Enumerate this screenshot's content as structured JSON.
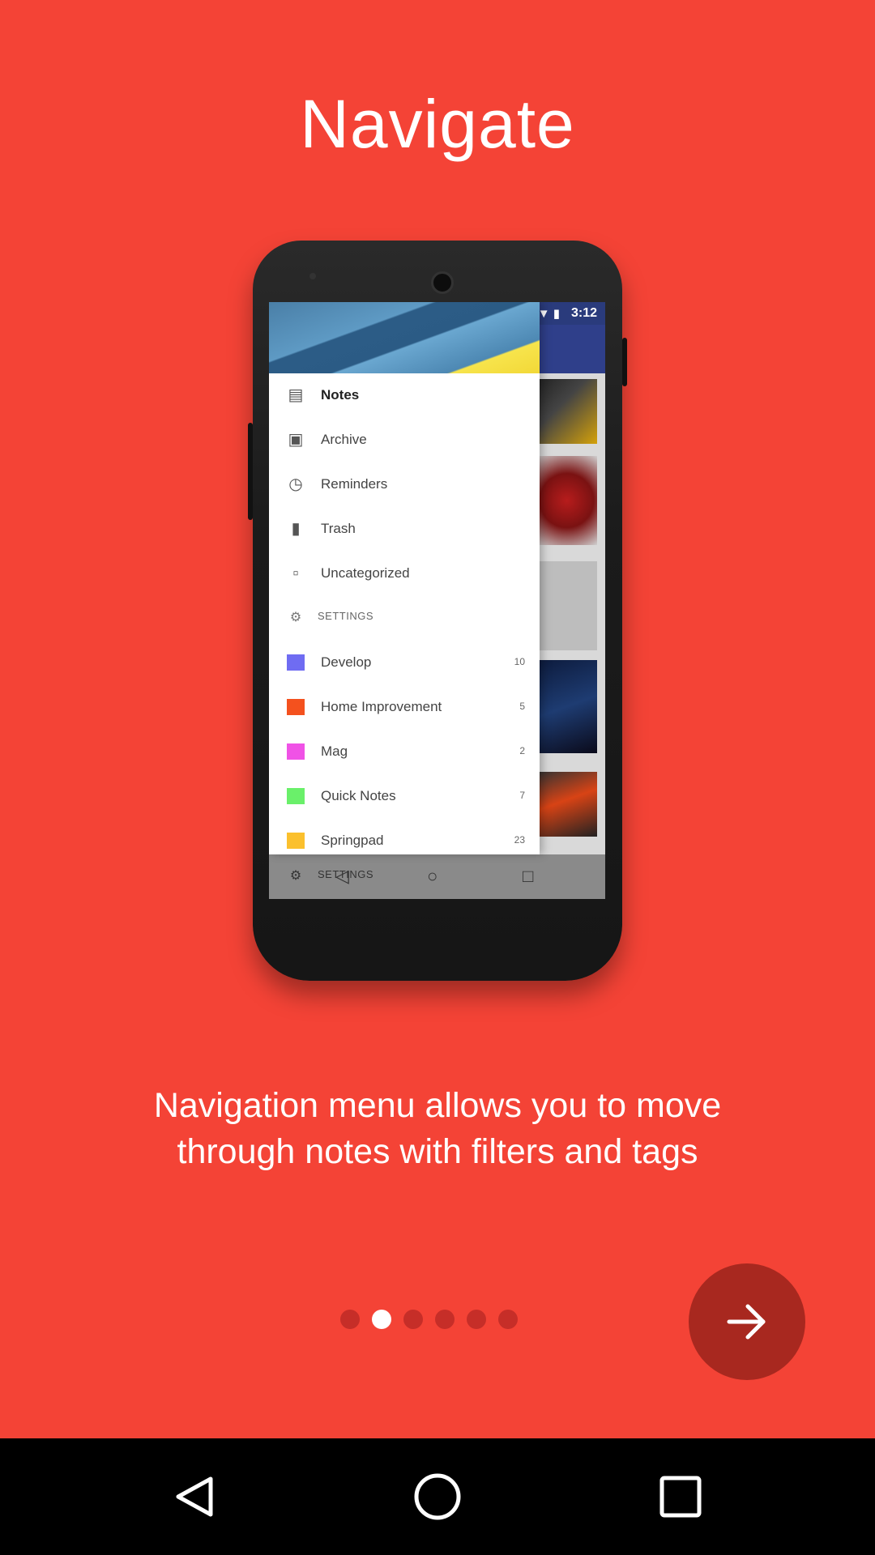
{
  "onboarding": {
    "title": "Navigate",
    "description": "Navigation menu allows you to move through notes with filters and tags",
    "page_count": 6,
    "active_page_index": 1,
    "next_button_icon": "arrow-right-icon"
  },
  "phone_mockup": {
    "status_time": "3:12",
    "drawer": {
      "items": [
        {
          "icon": "note-icon",
          "label": "Notes"
        },
        {
          "icon": "archive-icon",
          "label": "Archive"
        },
        {
          "icon": "alarm-icon",
          "label": "Reminders"
        },
        {
          "icon": "trash-icon",
          "label": "Trash"
        },
        {
          "icon": "folder-icon",
          "label": "Uncategorized"
        }
      ],
      "section_header": "SETTINGS",
      "categories": [
        {
          "label": "Develop",
          "count": "10",
          "color": "#6f6cf2"
        },
        {
          "label": "Home Improvement",
          "count": "5",
          "color": "#f4511e"
        },
        {
          "label": "Mag",
          "count": "2",
          "color": "#f052e6"
        },
        {
          "label": "Quick Notes",
          "count": "7",
          "color": "#6af06a"
        },
        {
          "label": "Springpad",
          "count": "23",
          "color": "#fbc02d"
        }
      ],
      "footer_label": "SETTINGS"
    }
  },
  "colors": {
    "background": "#f44336",
    "fab": "#a8281f",
    "dot_inactive": "#c62e28",
    "dot_active": "#ffffff"
  }
}
